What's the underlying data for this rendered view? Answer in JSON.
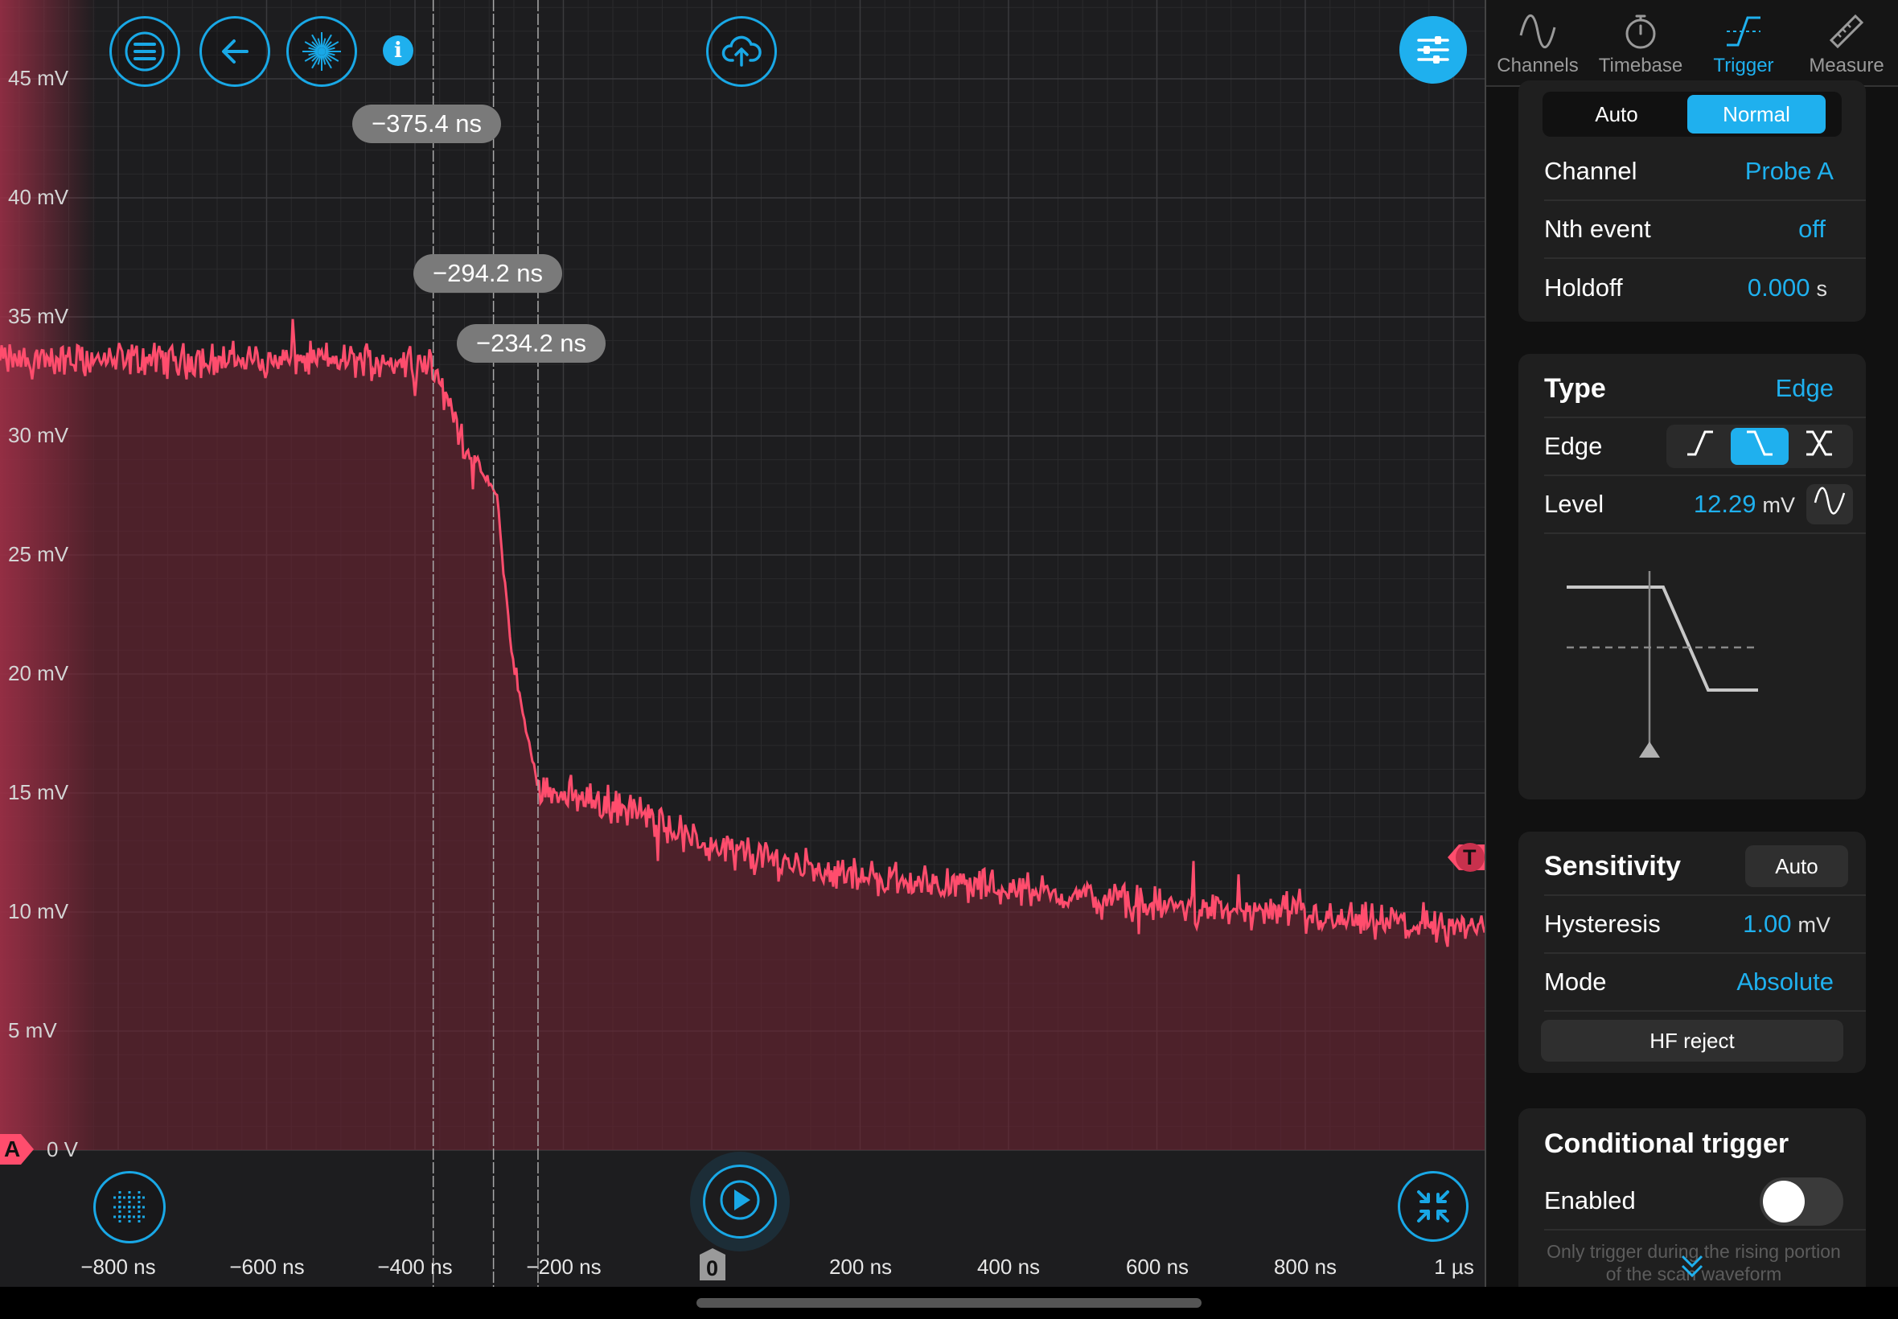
{
  "scope": {
    "y_axis_labels": [
      "45 mV",
      "40 mV",
      "35 mV",
      "30 mV",
      "25 mV",
      "20 mV",
      "15 mV",
      "10 mV",
      "5 mV",
      "0 V"
    ],
    "x_axis_labels": [
      "−800 ns",
      "−600 ns",
      "−400 ns",
      "−200 ns",
      "0",
      "200 ns",
      "400 ns",
      "600 ns",
      "800 ns",
      "1 µs"
    ],
    "cursors": [
      "−375.4 ns",
      "−294.2 ns",
      "−234.2 ns"
    ],
    "channel_marker": "A",
    "trigger_marker": "T",
    "zero_marker": "0",
    "trace_color": "#ff4d6d",
    "accent_color": "#1fb0ee",
    "toolbar_icons": [
      "menu-icon",
      "back-arrow-icon",
      "burst-icon",
      "info-icon",
      "cloud-upload-icon",
      "settings-sliders-icon"
    ],
    "bottom_icons": [
      "grid-icon",
      "play-icon",
      "collapse-icon"
    ],
    "trace_samples_mv": {
      "t_ns": [
        -1000,
        -380,
        -330,
        -290,
        -270,
        -250,
        -234,
        -100,
        0,
        200,
        400,
        600,
        800,
        1000
      ],
      "v_mv": [
        33.2,
        33.2,
        29.5,
        27.5,
        21.0,
        17.5,
        15.3,
        14.2,
        12.7,
        11.5,
        11.0,
        10.3,
        9.8,
        9.3
      ]
    }
  },
  "sidebar": {
    "tabs": [
      {
        "label": "Channels",
        "icon": "sine-icon"
      },
      {
        "label": "Timebase",
        "icon": "stopwatch-icon"
      },
      {
        "label": "Trigger",
        "icon": "trigger-edge-icon",
        "active": true
      },
      {
        "label": "Measure",
        "icon": "ruler-icon"
      }
    ],
    "mode": {
      "options": [
        "Auto",
        "Normal"
      ],
      "selected": "Normal"
    },
    "channel": {
      "label": "Channel",
      "value": "Probe A"
    },
    "nth_event": {
      "label": "Nth event",
      "value": "off"
    },
    "holdoff": {
      "label": "Holdoff",
      "value": "0.000",
      "unit": "s"
    },
    "type": {
      "label": "Type",
      "value": "Edge"
    },
    "edge": {
      "label": "Edge",
      "selected": "falling"
    },
    "level": {
      "label": "Level",
      "value": "12.29",
      "unit": "mV"
    },
    "sensitivity": {
      "label": "Sensitivity",
      "button": "Auto"
    },
    "hysteresis": {
      "label": "Hysteresis",
      "value": "1.00",
      "unit": "mV"
    },
    "mode_row": {
      "label": "Mode",
      "value": "Absolute"
    },
    "hf_reject": "HF reject",
    "conditional": {
      "title": "Conditional trigger",
      "enabled_label": "Enabled",
      "enabled": false,
      "hint": "Only trigger during the rising portion of the scan waveform"
    }
  }
}
